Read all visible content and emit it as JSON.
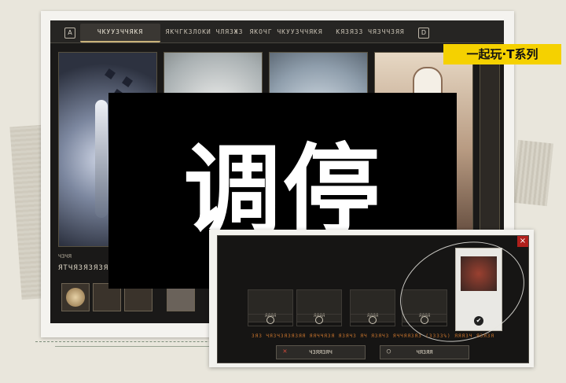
{
  "game": {
    "tab_key_left": "A",
    "tab_key_right": "D",
    "tabs": [
      {
        "label": "ЧКУУЗЧЧЯКЯ"
      },
      {
        "label": "ЯКЧГКЗЛОКИ ЧЛЯЗЖЗ"
      },
      {
        "label": "ЯКОЧГ ЧКУУЗЧЧЯКЯ"
      },
      {
        "label": "КЯЗЯЗЗ ЧЯЗЧЧЗЯЯ"
      }
    ],
    "active_tab_index": 0,
    "card_subtitle": "ЧЗЧЯ",
    "card_title": "ЯТЧЯЗЯЗЯЗЯЯ"
  },
  "series_badge": "一起玩·T系列",
  "pause_text": "调停",
  "popup": {
    "close_label": "×",
    "slots": [
      {
        "label": "ЯЯЯЯ"
      },
      {
        "label": "ЯЯЯЯ"
      },
      {
        "label": "ЯЯЯЯ"
      },
      {
        "label": "ЯЯЯЯ"
      }
    ],
    "selected_check": "✔",
    "info_text": "ЗЯЗ ЧЯЗЧЗЯЗЯЗЯЯ ЯЯЧЧЯЗЯ ЯЗЯЧЗ  ЯЧ ЯЗЯЧЗ ЯЧЧЯЯЗЯЗ (ЗЗЗЗ%) ЯЯЯЗЧ ЯЗЯЗЯ",
    "cancel_label": "ЧЗЯЯЗЯЧ",
    "confirm_label": "ЧЯЗЯЯ",
    "cancel_icon": "✕",
    "confirm_icon": "○"
  },
  "colors": {
    "badge_yellow": "#f5d100",
    "overlay_black": "#000000",
    "close_red": "#b0201c",
    "accent_gold": "#c8b27a"
  }
}
